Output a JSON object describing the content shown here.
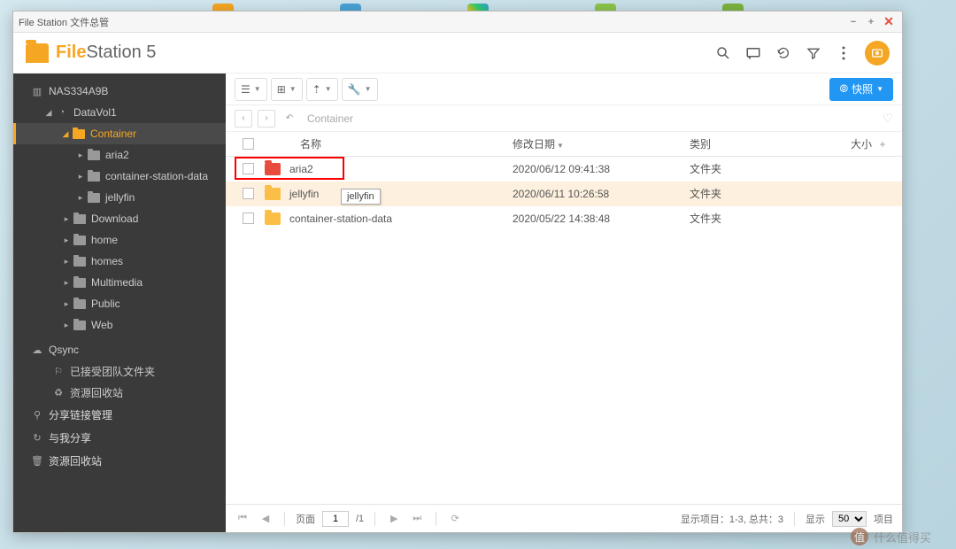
{
  "window": {
    "title": "File Station 文件总管"
  },
  "app": {
    "brand": "File",
    "name": "Station 5"
  },
  "snapshot_button": "快照",
  "breadcrumb": "Container",
  "tree": {
    "root": "NAS334A9B",
    "vol": "DataVol1",
    "container": "Container",
    "container_children": [
      "aria2",
      "container-station-data",
      "jellyfin"
    ],
    "folders": [
      "Download",
      "home",
      "homes",
      "Multimedia",
      "Public",
      "Web"
    ],
    "qsync": "Qsync",
    "qsync_children": [
      "已接受团队文件夹",
      "资源回收站"
    ],
    "sections": [
      "分享链接管理",
      "与我分享",
      "资源回收站"
    ]
  },
  "columns": {
    "name": "名称",
    "date": "修改日期",
    "type": "类别",
    "size": "大小"
  },
  "rows": [
    {
      "name": "aria2",
      "date": "2020/06/12 09:41:38",
      "type": "文件夹",
      "highlight": true
    },
    {
      "name": "jellyfin",
      "date": "2020/06/11 10:26:58",
      "type": "文件夹",
      "hover": true
    },
    {
      "name": "container-station-data",
      "date": "2020/05/22 14:38:48",
      "type": "文件夹"
    }
  ],
  "tooltip": "jellyfin",
  "footer": {
    "page_label": "页面",
    "page": "1",
    "total_pages": "/1",
    "showing": "显示项目：1-3, 总共：3",
    "display_label": "显示",
    "per_page": "50",
    "items_label": "项目"
  },
  "watermark": "什么值得买"
}
